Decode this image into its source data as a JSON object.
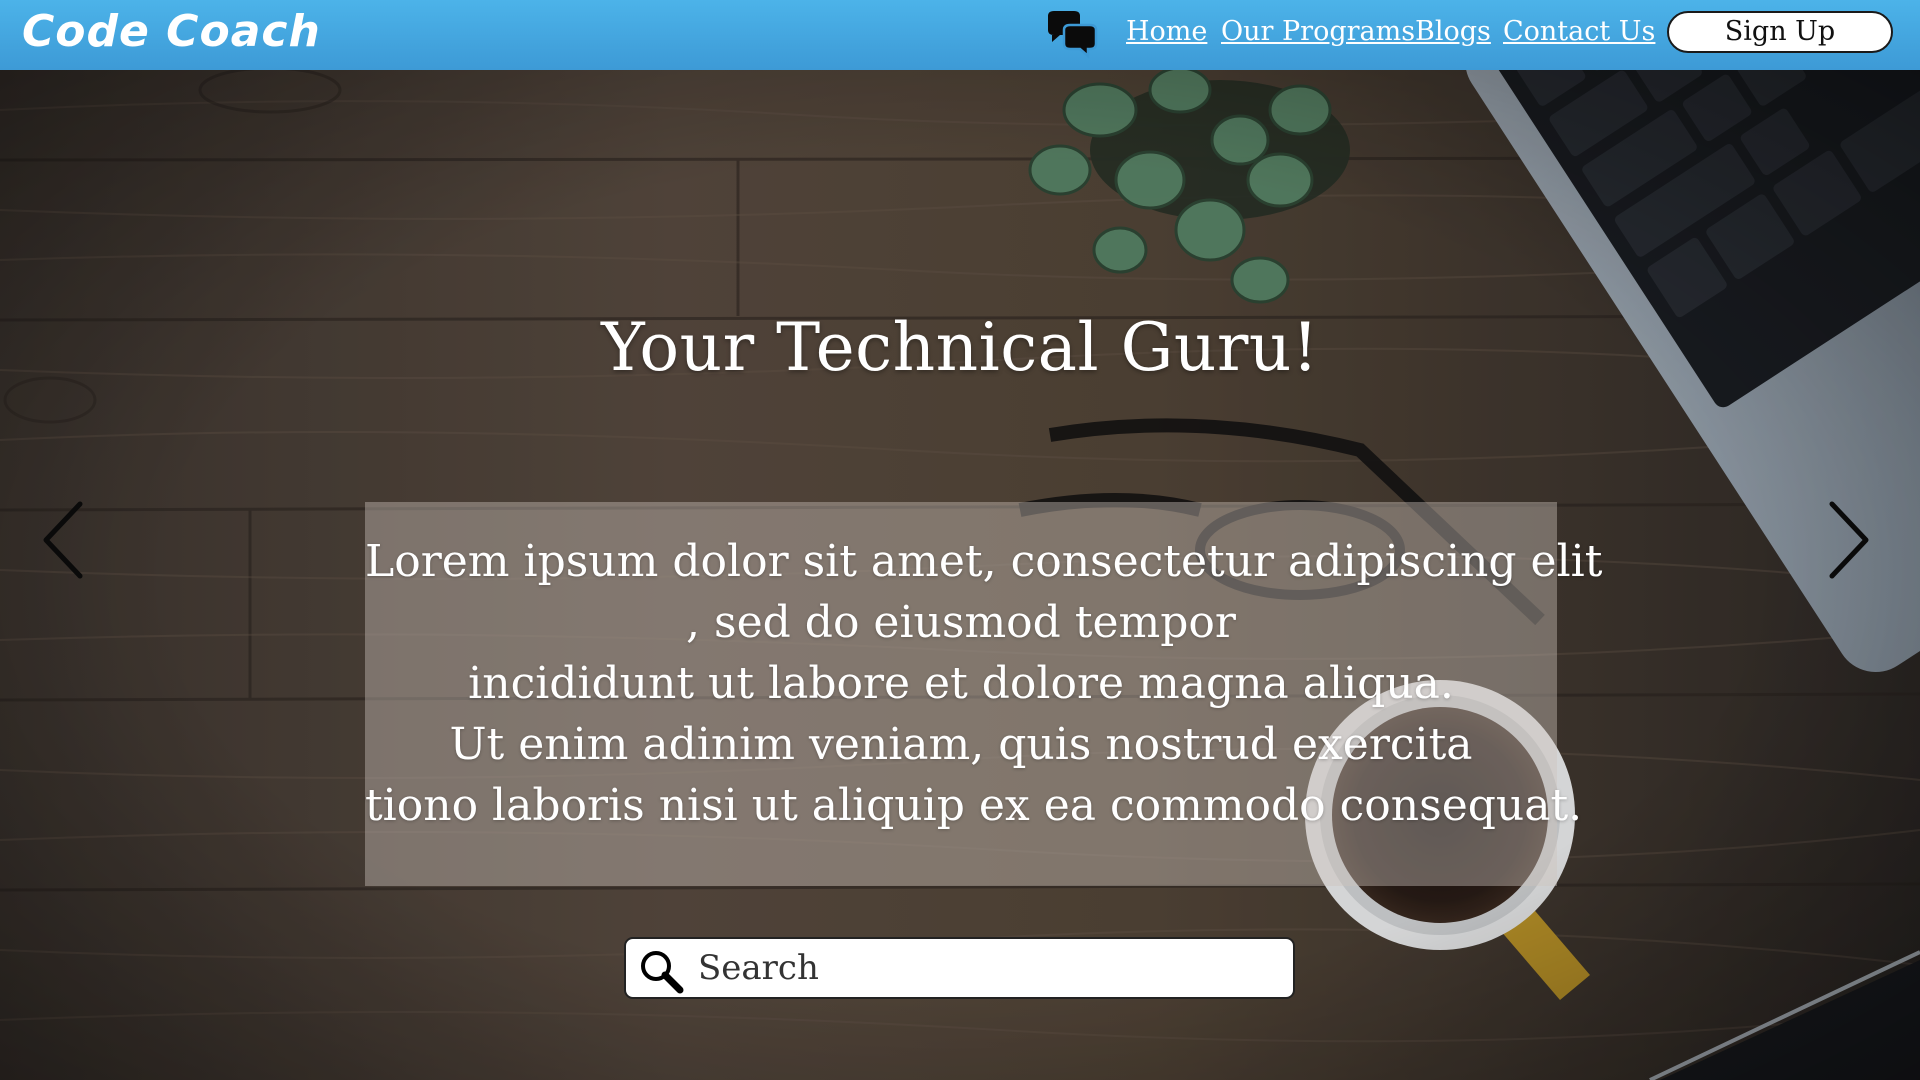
{
  "header": {
    "logo": "Code Coach",
    "chat_icon": "chat-bubbles-icon",
    "nav": [
      "Home",
      "Our Programs",
      "Blogs",
      "Contact Us"
    ],
    "signup_label": "Sign Up"
  },
  "hero": {
    "headline": "Your Technical Guru!",
    "description_lines": [
      "Lorem ipsum dolor sit amet, consectetur adipiscing elit",
      ", sed do eiusmod tempor",
      "incididunt ut labore et dolore magna aliqua.",
      "Ut enim adinim veniam, quis nostrud exercita",
      "tiono laboris nisi ut aliquip ex ea commodo consequat."
    ],
    "prev_icon": "chevron-left-icon",
    "next_icon": "chevron-right-icon"
  },
  "search": {
    "placeholder": "Search",
    "icon": "search-icon"
  },
  "colors": {
    "header_bg": "#4cb3e9",
    "wood_dark": "#3c3530",
    "wood_light": "#6b5b4e"
  }
}
